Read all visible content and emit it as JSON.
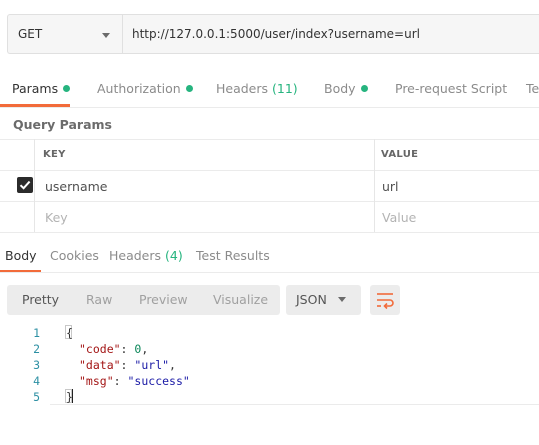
{
  "request": {
    "method": "GET",
    "url": "http://127.0.0.1:5000/user/index?username=url"
  },
  "request_tabs": [
    {
      "label": "Params",
      "dot": true,
      "active": true
    },
    {
      "label": "Authorization",
      "dot": true
    },
    {
      "label": "Headers",
      "count": "(11)"
    },
    {
      "label": "Body",
      "dot": true
    },
    {
      "label": "Pre-request Script"
    },
    {
      "label": "Te"
    }
  ],
  "query_params": {
    "title": "Query Params",
    "columns": [
      "KEY",
      "VALUE"
    ],
    "rows": [
      {
        "checked": true,
        "key": "username",
        "value": "url"
      }
    ],
    "placeholder_key": "Key",
    "placeholder_value": "Value"
  },
  "response_tabs": [
    {
      "label": "Body",
      "active": true
    },
    {
      "label": "Cookies"
    },
    {
      "label": "Headers",
      "count": "(4)"
    },
    {
      "label": "Test Results"
    }
  ],
  "view_modes": [
    "Pretty",
    "Raw",
    "Preview",
    "Visualize"
  ],
  "format": "JSON",
  "code_lines": {
    "numbers": [
      "1",
      "2",
      "3",
      "4",
      "5"
    ],
    "open_brace": "{",
    "close_brace": "}",
    "code_key": "\"code\"",
    "code_val": "0",
    "data_key": "\"data\"",
    "data_val": "\"url\"",
    "msg_key": "\"msg\"",
    "msg_val": "\"success\"",
    "colon": ":",
    "comma": ","
  },
  "colors": {
    "accent": "#f26b3a",
    "status_green": "#26b47f"
  },
  "icons": [
    "chevron-down-icon",
    "checkbox-checked-icon",
    "wrap-lines-icon"
  ]
}
